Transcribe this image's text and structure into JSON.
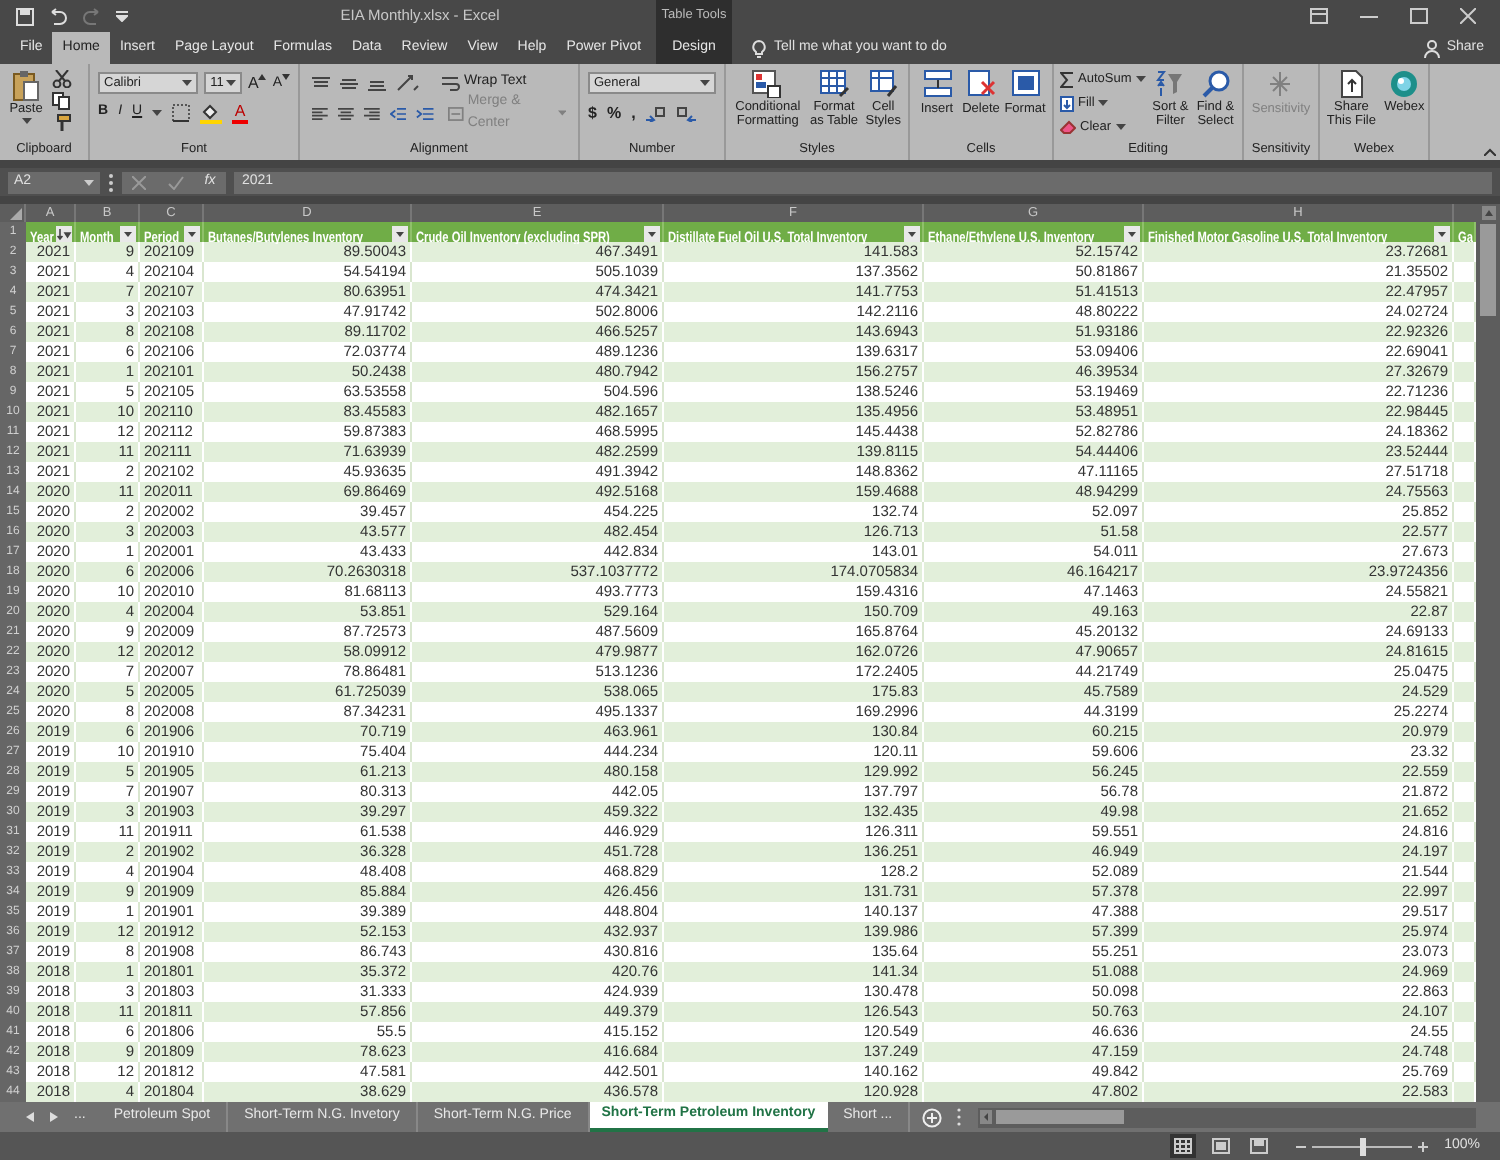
{
  "title_bar": {
    "title": "EIA Monthly.xlsx  -  Excel",
    "context_label": "Table Tools"
  },
  "ribbon_tabs": [
    {
      "label": "File",
      "selected": false,
      "kind": "normal"
    },
    {
      "label": "Home",
      "selected": true,
      "kind": "normal"
    },
    {
      "label": "Insert",
      "selected": false,
      "kind": "normal"
    },
    {
      "label": "Page Layout",
      "selected": false,
      "kind": "normal"
    },
    {
      "label": "Formulas",
      "selected": false,
      "kind": "normal"
    },
    {
      "label": "Data",
      "selected": false,
      "kind": "normal"
    },
    {
      "label": "Review",
      "selected": false,
      "kind": "normal"
    },
    {
      "label": "View",
      "selected": false,
      "kind": "normal"
    },
    {
      "label": "Help",
      "selected": false,
      "kind": "normal"
    },
    {
      "label": "Power Pivot",
      "selected": false,
      "kind": "normal"
    },
    {
      "label": "Design",
      "selected": false,
      "kind": "contextual"
    }
  ],
  "tell_me": {
    "placeholder": "Tell me what you want to do"
  },
  "share": "Share",
  "ribbon": {
    "clipboard": {
      "label": "Clipboard",
      "paste": "Paste"
    },
    "font": {
      "label": "Font",
      "font_name": "Calibri",
      "font_size": "11",
      "grow": "A",
      "shrink": "A",
      "bold": "B",
      "italic": "I",
      "underline": "U",
      "font_color": "A"
    },
    "alignment": {
      "label": "Alignment",
      "wrap_text": "Wrap Text",
      "merge_center": {
        "label": "Merge & Center",
        "disabled": true
      }
    },
    "number": {
      "label": "Number",
      "format": "General",
      "currency": "$",
      "percent": "%",
      "comma": ","
    },
    "styles": {
      "label": "Styles",
      "conditional": "Conditional Formatting",
      "format_table": "Format as Table",
      "cell_styles": "Cell Styles"
    },
    "cells": {
      "label": "Cells",
      "insert": "Insert",
      "delete": "Delete",
      "format": "Format"
    },
    "editing": {
      "label": "Editing",
      "autosum": "AutoSum",
      "fill": "Fill",
      "clear": "Clear",
      "sort_filter": "Sort & Filter",
      "find_select": "Find & Select"
    },
    "sensitivity": {
      "label": "Sensitivity",
      "button": {
        "label": "Sensitivity",
        "disabled": true
      }
    },
    "webex": {
      "label": "Webex",
      "share_file": "Share This File",
      "webex": "Webex"
    }
  },
  "formula_bar": {
    "name_box": "A2",
    "function_label": "fx",
    "value": "2021"
  },
  "column_letters": [
    "A",
    "B",
    "C",
    "D",
    "E",
    "F",
    "G",
    "H"
  ],
  "table": {
    "header_row": "1",
    "headers": [
      {
        "label": "Year",
        "kind": "sorted"
      },
      {
        "label": "Month",
        "kind": "dropdown"
      },
      {
        "label": "Period",
        "kind": "dropdown"
      },
      {
        "label": "Butanes/Butylenes Inventory",
        "kind": "dropdown"
      },
      {
        "label": "Crude Oil Inventory (excluding SPR)",
        "kind": "dropdown"
      },
      {
        "label": "Distillate Fuel Oil U.S. Total Inventory",
        "kind": "dropdown"
      },
      {
        "label": "Ethane/Ethylene U.S. Inventory",
        "kind": "dropdown"
      },
      {
        "label": "Finished Motor Gasoline U.S. Total Inventory",
        "kind": "dropdown"
      },
      {
        "label": "Ga",
        "kind": "plain"
      }
    ],
    "rows": [
      {
        "row": "2",
        "cells": [
          "2021",
          "9",
          "202109",
          "89.50043",
          "467.3491",
          "141.583",
          "52.15742",
          "23.72681"
        ]
      },
      {
        "row": "3",
        "cells": [
          "2021",
          "4",
          "202104",
          "54.54194",
          "505.1039",
          "137.3562",
          "50.81867",
          "21.35502"
        ]
      },
      {
        "row": "4",
        "cells": [
          "2021",
          "7",
          "202107",
          "80.63951",
          "474.3421",
          "141.7753",
          "51.41513",
          "22.47957"
        ]
      },
      {
        "row": "5",
        "cells": [
          "2021",
          "3",
          "202103",
          "47.91742",
          "502.8006",
          "142.2116",
          "48.80222",
          "24.02724"
        ]
      },
      {
        "row": "6",
        "cells": [
          "2021",
          "8",
          "202108",
          "89.11702",
          "466.5257",
          "143.6943",
          "51.93186",
          "22.92326"
        ]
      },
      {
        "row": "7",
        "cells": [
          "2021",
          "6",
          "202106",
          "72.03774",
          "489.1236",
          "139.6317",
          "53.09406",
          "22.69041"
        ]
      },
      {
        "row": "8",
        "cells": [
          "2021",
          "1",
          "202101",
          "50.2438",
          "480.7942",
          "156.2757",
          "46.39534",
          "27.32679"
        ]
      },
      {
        "row": "9",
        "cells": [
          "2021",
          "5",
          "202105",
          "63.53558",
          "504.596",
          "138.5246",
          "53.19469",
          "22.71236"
        ]
      },
      {
        "row": "10",
        "cells": [
          "2021",
          "10",
          "202110",
          "83.45583",
          "482.1657",
          "135.4956",
          "53.48951",
          "22.98445"
        ]
      },
      {
        "row": "11",
        "cells": [
          "2021",
          "12",
          "202112",
          "59.87383",
          "468.5995",
          "145.4438",
          "52.82786",
          "24.18362"
        ]
      },
      {
        "row": "12",
        "cells": [
          "2021",
          "11",
          "202111",
          "71.63939",
          "482.2599",
          "139.8115",
          "54.44406",
          "23.52444"
        ]
      },
      {
        "row": "13",
        "cells": [
          "2021",
          "2",
          "202102",
          "45.93635",
          "491.3942",
          "148.8362",
          "47.11165",
          "27.51718"
        ]
      },
      {
        "row": "14",
        "cells": [
          "2020",
          "11",
          "202011",
          "69.86469",
          "492.5168",
          "159.4688",
          "48.94299",
          "24.75563"
        ]
      },
      {
        "row": "15",
        "cells": [
          "2020",
          "2",
          "202002",
          "39.457",
          "454.225",
          "132.74",
          "52.097",
          "25.852"
        ]
      },
      {
        "row": "16",
        "cells": [
          "2020",
          "3",
          "202003",
          "43.577",
          "482.454",
          "126.713",
          "51.58",
          "22.577"
        ]
      },
      {
        "row": "17",
        "cells": [
          "2020",
          "1",
          "202001",
          "43.433",
          "442.834",
          "143.01",
          "54.011",
          "27.673"
        ]
      },
      {
        "row": "18",
        "cells": [
          "2020",
          "6",
          "202006",
          "70.2630318",
          "537.1037772",
          "174.0705834",
          "46.164217",
          "23.9724356"
        ]
      },
      {
        "row": "19",
        "cells": [
          "2020",
          "10",
          "202010",
          "81.68113",
          "493.7773",
          "159.4316",
          "47.1463",
          "24.55821"
        ]
      },
      {
        "row": "20",
        "cells": [
          "2020",
          "4",
          "202004",
          "53.851",
          "529.164",
          "150.709",
          "49.163",
          "22.87"
        ]
      },
      {
        "row": "21",
        "cells": [
          "2020",
          "9",
          "202009",
          "87.72573",
          "487.5609",
          "165.8764",
          "45.20132",
          "24.69133"
        ]
      },
      {
        "row": "22",
        "cells": [
          "2020",
          "12",
          "202012",
          "58.09912",
          "479.9877",
          "162.0726",
          "47.90657",
          "24.81615"
        ]
      },
      {
        "row": "23",
        "cells": [
          "2020",
          "7",
          "202007",
          "78.86481",
          "513.1236",
          "172.2405",
          "44.21749",
          "25.0475"
        ]
      },
      {
        "row": "24",
        "cells": [
          "2020",
          "5",
          "202005",
          "61.725039",
          "538.065",
          "175.83",
          "45.7589",
          "24.529"
        ]
      },
      {
        "row": "25",
        "cells": [
          "2020",
          "8",
          "202008",
          "87.34231",
          "495.1337",
          "169.2996",
          "44.3199",
          "25.2274"
        ]
      },
      {
        "row": "26",
        "cells": [
          "2019",
          "6",
          "201906",
          "70.719",
          "463.961",
          "130.84",
          "60.215",
          "20.979"
        ]
      },
      {
        "row": "27",
        "cells": [
          "2019",
          "10",
          "201910",
          "75.404",
          "444.234",
          "120.11",
          "59.606",
          "23.32"
        ]
      },
      {
        "row": "28",
        "cells": [
          "2019",
          "5",
          "201905",
          "61.213",
          "480.158",
          "129.992",
          "56.245",
          "22.559"
        ]
      },
      {
        "row": "29",
        "cells": [
          "2019",
          "7",
          "201907",
          "80.313",
          "442.05",
          "137.797",
          "56.78",
          "21.872"
        ]
      },
      {
        "row": "30",
        "cells": [
          "2019",
          "3",
          "201903",
          "39.297",
          "459.322",
          "132.435",
          "49.98",
          "21.652"
        ]
      },
      {
        "row": "31",
        "cells": [
          "2019",
          "11",
          "201911",
          "61.538",
          "446.929",
          "126.311",
          "59.551",
          "24.816"
        ]
      },
      {
        "row": "32",
        "cells": [
          "2019",
          "2",
          "201902",
          "36.328",
          "451.728",
          "136.251",
          "46.949",
          "24.197"
        ]
      },
      {
        "row": "33",
        "cells": [
          "2019",
          "4",
          "201904",
          "48.408",
          "468.829",
          "128.2",
          "52.089",
          "21.544"
        ]
      },
      {
        "row": "34",
        "cells": [
          "2019",
          "9",
          "201909",
          "85.884",
          "426.456",
          "131.731",
          "57.378",
          "22.997"
        ]
      },
      {
        "row": "35",
        "cells": [
          "2019",
          "1",
          "201901",
          "39.389",
          "448.804",
          "140.137",
          "47.388",
          "29.517"
        ]
      },
      {
        "row": "36",
        "cells": [
          "2019",
          "12",
          "201912",
          "52.153",
          "432.937",
          "139.986",
          "57.399",
          "25.974"
        ]
      },
      {
        "row": "37",
        "cells": [
          "2019",
          "8",
          "201908",
          "86.743",
          "430.816",
          "135.64",
          "55.251",
          "23.073"
        ]
      },
      {
        "row": "38",
        "cells": [
          "2018",
          "1",
          "201801",
          "35.372",
          "420.76",
          "141.34",
          "51.088",
          "24.969"
        ]
      },
      {
        "row": "39",
        "cells": [
          "2018",
          "3",
          "201803",
          "31.333",
          "424.939",
          "130.478",
          "50.098",
          "22.863"
        ]
      },
      {
        "row": "40",
        "cells": [
          "2018",
          "11",
          "201811",
          "57.856",
          "449.379",
          "126.543",
          "50.763",
          "24.107"
        ]
      },
      {
        "row": "41",
        "cells": [
          "2018",
          "6",
          "201806",
          "55.5",
          "415.152",
          "120.549",
          "46.636",
          "24.55"
        ]
      },
      {
        "row": "42",
        "cells": [
          "2018",
          "9",
          "201809",
          "78.623",
          "416.684",
          "137.249",
          "47.159",
          "24.748"
        ]
      },
      {
        "row": "43",
        "cells": [
          "2018",
          "12",
          "201812",
          "47.581",
          "442.501",
          "140.162",
          "49.842",
          "25.769"
        ]
      },
      {
        "row": "44",
        "cells": [
          "2018",
          "4",
          "201804",
          "38.629",
          "436.578",
          "120.928",
          "47.802",
          "22.583"
        ]
      }
    ]
  },
  "sheet_nav": {
    "more": "..."
  },
  "sheet_tabs": [
    {
      "label": "Petroleum Spot",
      "selected": false
    },
    {
      "label": "Short-Term N.G. Invetory",
      "selected": false
    },
    {
      "label": "Short-Term N.G. Price",
      "selected": false
    },
    {
      "label": "Short-Term Petroleum Inventory",
      "selected": true
    },
    {
      "label": "Short ...",
      "selected": false
    }
  ],
  "status_bar": {
    "views": [
      {
        "selected": true
      },
      {
        "selected": false
      },
      {
        "selected": false
      }
    ],
    "zoom_slider": {
      "level": 0.5
    },
    "zoom": "100%"
  }
}
